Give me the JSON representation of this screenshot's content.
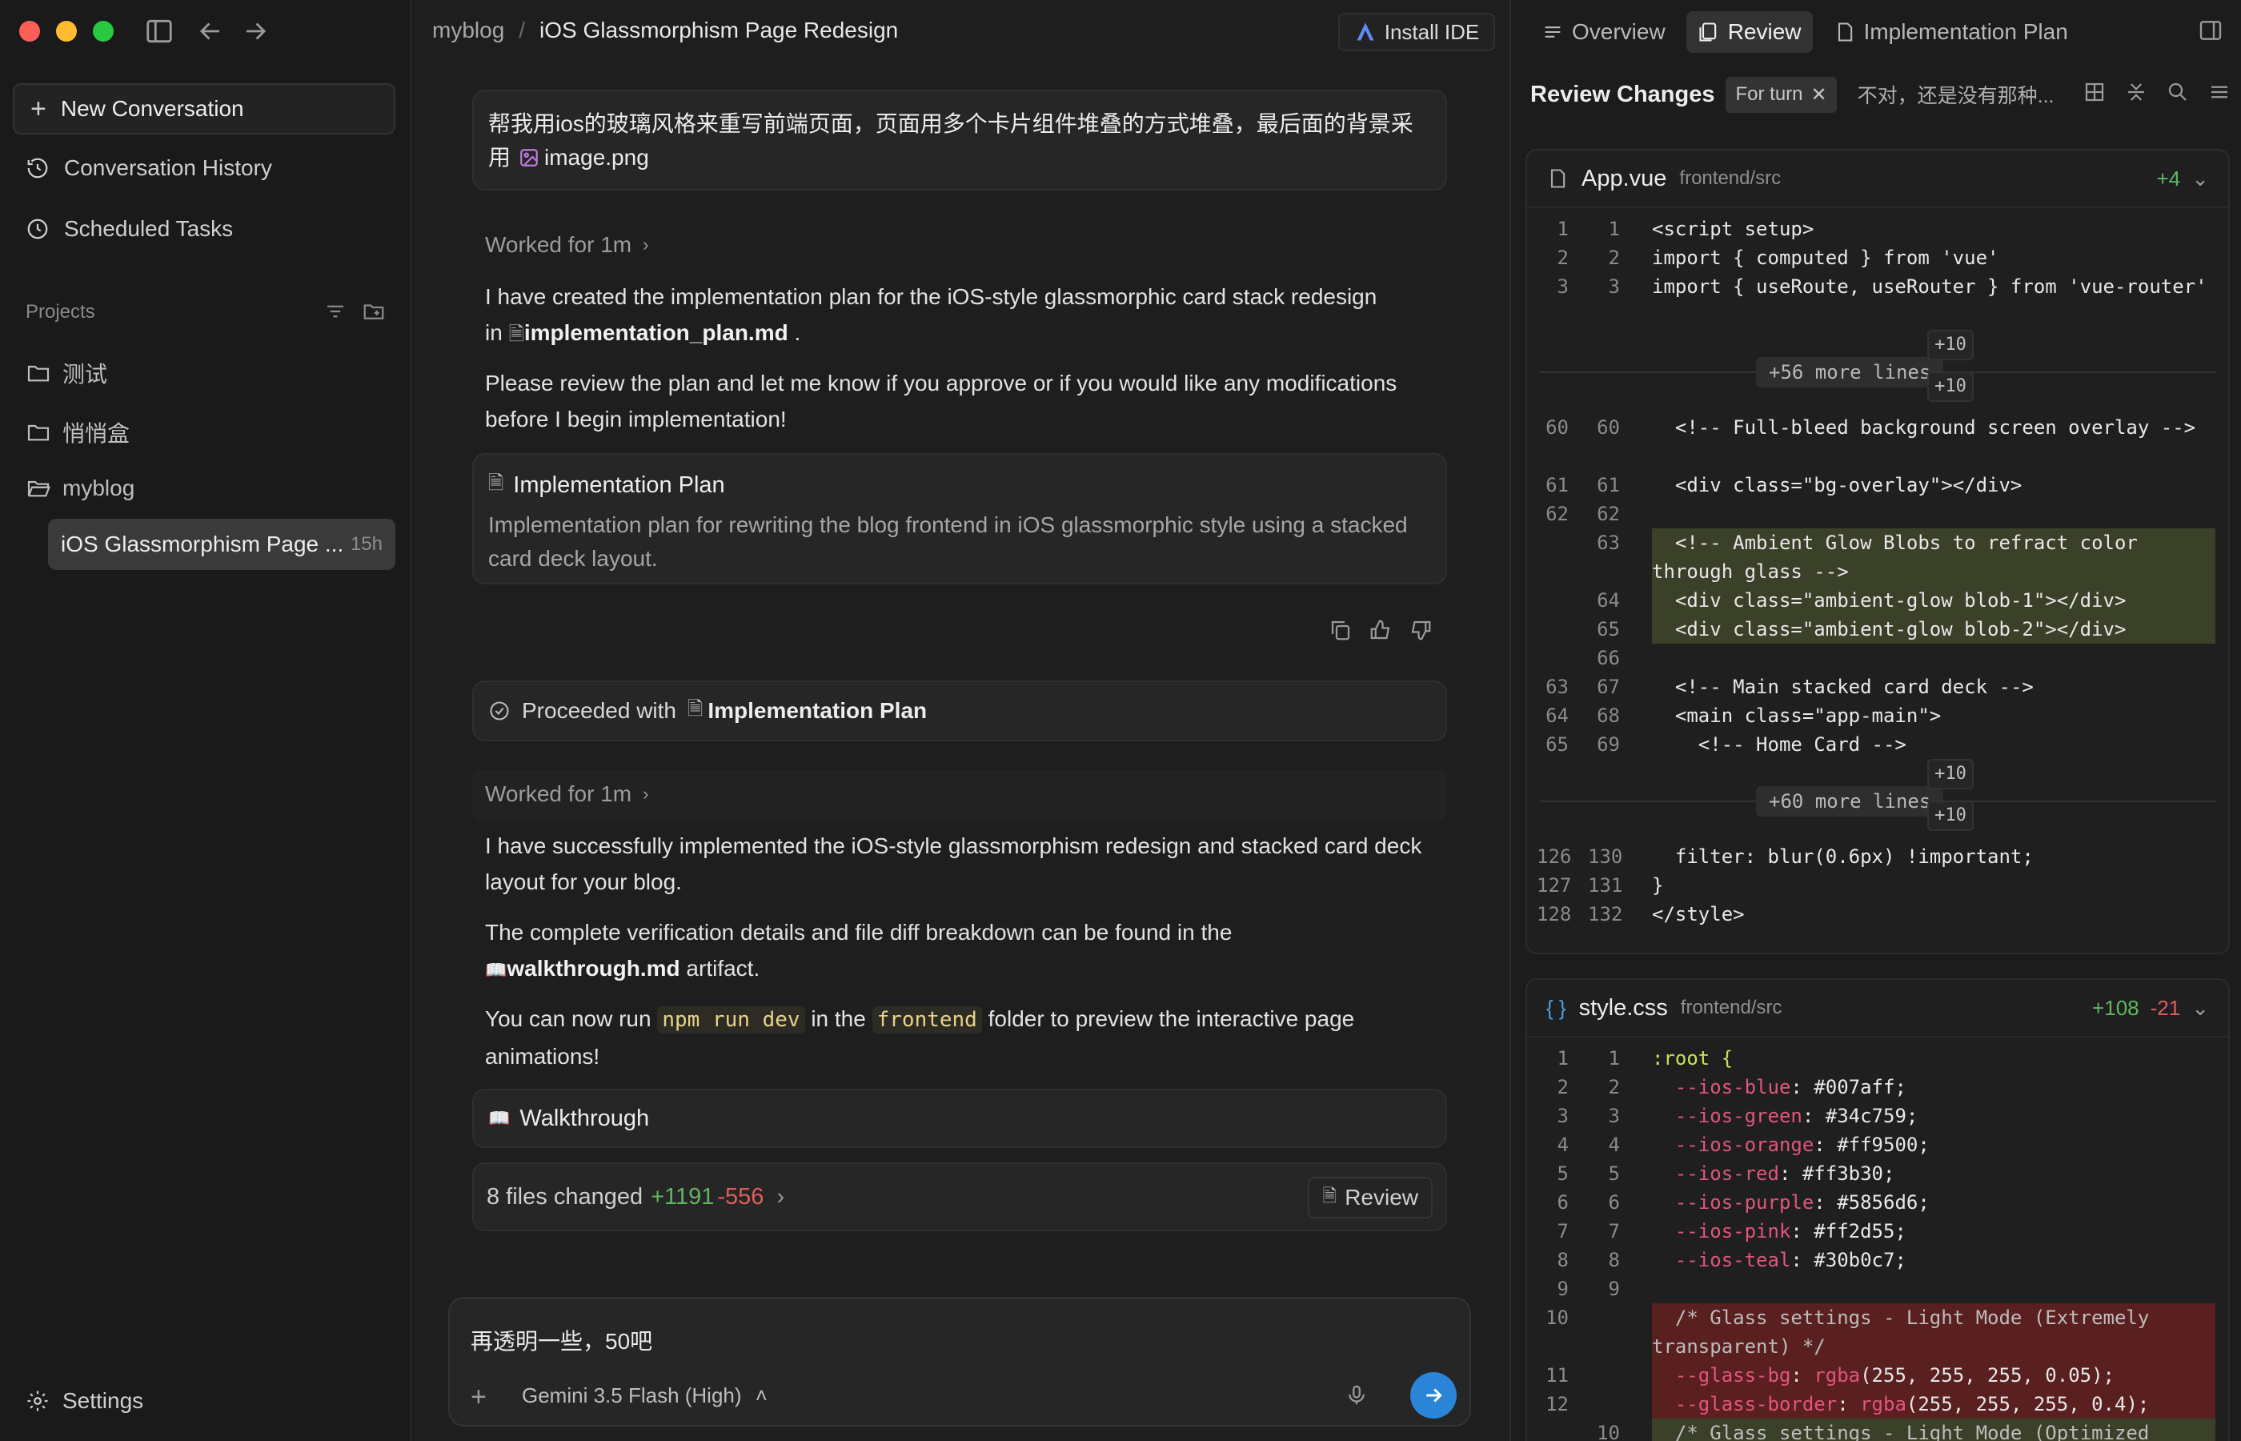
{
  "sidebar": {
    "new_conversation": "New Conversation",
    "conversation_history": "Conversation History",
    "scheduled_tasks": "Scheduled Tasks",
    "projects_label": "Projects",
    "folders": [
      "测试",
      "悄悄盒",
      "myblog"
    ],
    "active_conversation": {
      "title": "iOS Glassmorphism Page ...",
      "age": "15h"
    },
    "settings": "Settings"
  },
  "header": {
    "breadcrumb_root": "myblog",
    "breadcrumb_sep": "/",
    "breadcrumb_title": "iOS Glassmorphism Page Redesign",
    "install_ide": "Install IDE"
  },
  "chat": {
    "user_message_line1": "帮我用ios的玻璃风格来重写前端页面，页面用多个卡片组件堆叠的方式堆叠，最后面的背景采",
    "user_message_line2_prefix": "用",
    "user_message_attachment": "image.png",
    "worked_1": "Worked for 1m",
    "para1_a": "I have created the implementation plan for the iOS-style glassmorphic card stack redesign",
    "para1_b_prefix": "in",
    "para1_b_file": "implementation_plan.md",
    "para1_b_suffix": ".",
    "para2": "Please review the plan and let me know if you approve or if you would like any modifications before I begin implementation!",
    "artifact1_title": "Implementation Plan",
    "artifact1_desc": "Implementation plan for rewriting the blog frontend in iOS glassmorphic style using a stacked card deck layout.",
    "proceeded_prefix": "Proceeded with",
    "proceeded_item": "Implementation Plan",
    "worked_2": "Worked for 1m",
    "para3": "I have successfully implemented the iOS-style glassmorphism redesign and stacked card deck layout for your blog.",
    "para4_a": "The complete verification details and file diff breakdown can be found in the",
    "para4_file": "walkthrough.md",
    "para4_suffix": "artifact.",
    "para5_a": "You can now run",
    "para5_code1": "npm run dev",
    "para5_b": "in the",
    "para5_code2": "frontend",
    "para5_c": "folder to preview the interactive page",
    "para5_d": "animations!",
    "artifact2_title": "Walkthrough",
    "files_changed": "8 files changed",
    "additions": "+1191",
    "deletions": "-556",
    "review_button": "Review"
  },
  "composer": {
    "text": "再透明一些，50吧",
    "plus": "+",
    "model": "Gemini 3.5 Flash (High)"
  },
  "right_panel": {
    "tabs": [
      "Overview",
      "Review",
      "Implementation Plan"
    ],
    "active_tab": "Review",
    "review_title": "Review Changes",
    "chip": "For turn",
    "turn_text": "不对，还是没有那种...",
    "files": [
      {
        "name": "App.vue",
        "path": "frontend/src",
        "additions": "+4",
        "deletions": "",
        "head_lines": [
          {
            "o": "1",
            "n": "1",
            "t": "<script setup>"
          },
          {
            "o": "2",
            "n": "2",
            "t": "import { computed } from 'vue'"
          },
          {
            "o": "3",
            "n": "3",
            "t": "import { useRoute, useRouter } from 'vue-router'"
          }
        ],
        "collapsed_1": "+56 more lines",
        "mid_lines": [
          {
            "o": "60",
            "n": "60",
            "t": "  <!-- Full-bleed background screen overlay -->"
          },
          {
            "o": "61",
            "n": "61",
            "t": "  <div class=\"bg-overlay\"></div>"
          },
          {
            "o": "62",
            "n": "62",
            "t": ""
          },
          {
            "o": "",
            "n": "63",
            "t": "  <!-- Ambient Glow Blobs to refract color through glass -->"
          },
          {
            "o": "",
            "n": "64",
            "t": "  <div class=\"ambient-glow blob-1\"></div>"
          },
          {
            "o": "",
            "n": "65",
            "t": "  <div class=\"ambient-glow blob-2\"></div>"
          },
          {
            "o": "",
            "n": "66",
            "t": ""
          },
          {
            "o": "63",
            "n": "67",
            "t": "  <!-- Main stacked card deck -->"
          },
          {
            "o": "64",
            "n": "68",
            "t": "  <main class=\"app-main\">"
          },
          {
            "o": "65",
            "n": "69",
            "t": "    <!-- Home Card -->"
          }
        ],
        "collapsed_2": "+60 more lines",
        "tail_lines": [
          {
            "o": "126",
            "n": "130",
            "t": "  filter: blur(0.6px) !important;"
          },
          {
            "o": "127",
            "n": "131",
            "t": "}"
          },
          {
            "o": "128",
            "n": "132",
            "t": "</style>"
          }
        ]
      },
      {
        "name": "style.css",
        "path": "frontend/src",
        "additions": "+108",
        "deletions": "-21",
        "lines": [
          {
            "o": "1",
            "n": "1",
            "t": ":root {"
          },
          {
            "o": "2",
            "n": "2",
            "p": "--ios-blue",
            "v": ": #007aff;"
          },
          {
            "o": "3",
            "n": "3",
            "p": "--ios-green",
            "v": ": #34c759;"
          },
          {
            "o": "4",
            "n": "4",
            "p": "--ios-orange",
            "v": ": #ff9500;"
          },
          {
            "o": "5",
            "n": "5",
            "p": "--ios-red",
            "v": ": #ff3b30;"
          },
          {
            "o": "6",
            "n": "6",
            "p": "--ios-purple",
            "v": ": #5856d6;"
          },
          {
            "o": "7",
            "n": "7",
            "p": "--ios-pink",
            "v": ": #ff2d55;"
          },
          {
            "o": "8",
            "n": "8",
            "p": "--ios-teal",
            "v": ": #30b0c7;"
          },
          {
            "o": "9",
            "n": "9",
            "t": ""
          },
          {
            "o": "10",
            "n": "",
            "t": "  /* Glass settings - Light Mode (Extremely transparent) */"
          },
          {
            "o": "11",
            "n": "",
            "p": "--glass-bg",
            "f": "rgba",
            "v2": "(255, 255, 255, 0.05);"
          },
          {
            "o": "12",
            "n": "",
            "p": "--glass-border",
            "f": "rgba",
            "v2": "(255, 255, 255, 0.4);"
          },
          {
            "o": "",
            "n": "10",
            "t": "  /* Glass settings - Light Mode (Optimized"
          }
        ]
      }
    ],
    "plus10": "+10"
  },
  "colors": {
    "accent_blue": "#2b84d8",
    "add_green": "#5fb85f",
    "del_red": "#e05d5d",
    "added_line_bg": "#3a4128",
    "deleted_line_bg": "#5a1f1f"
  }
}
